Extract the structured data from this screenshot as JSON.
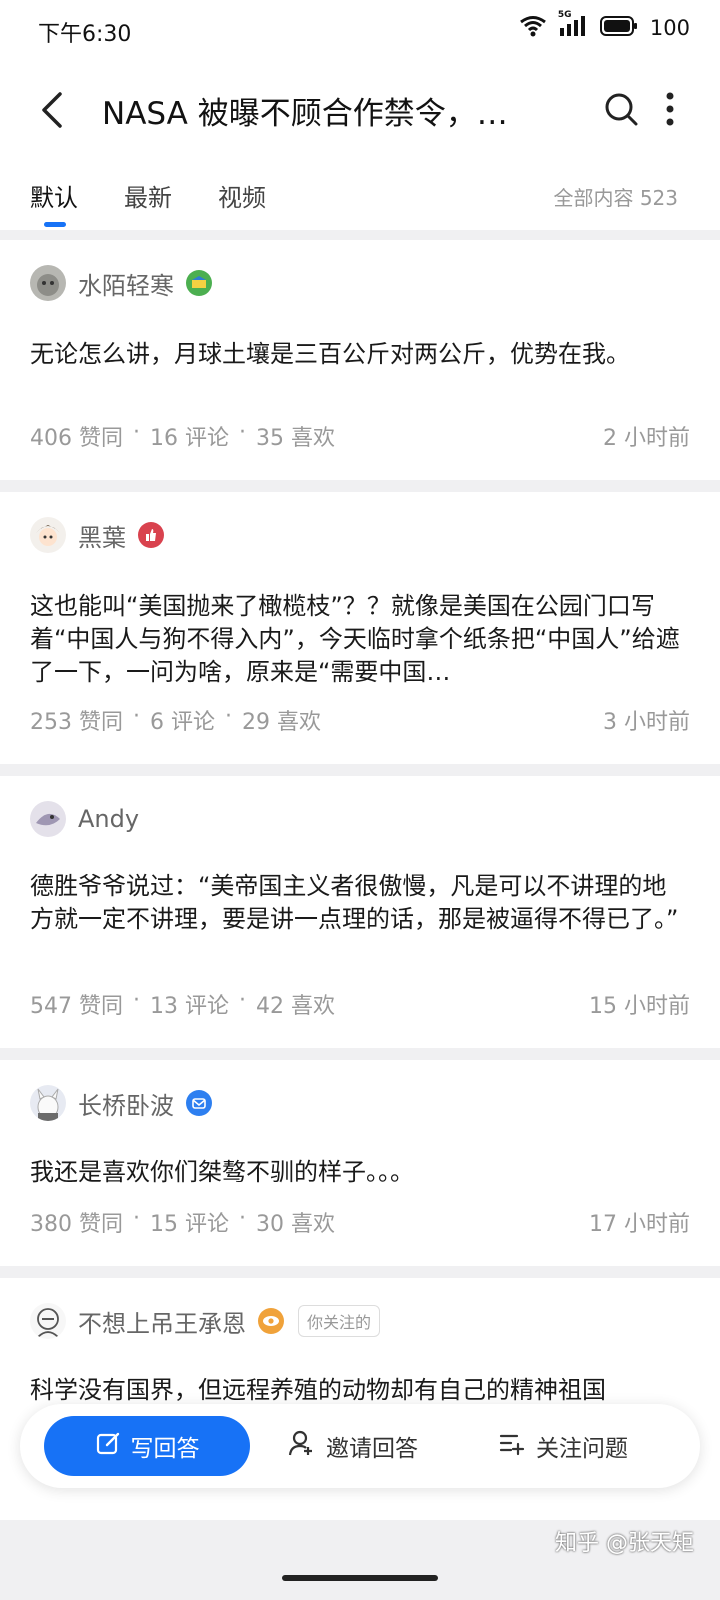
{
  "status": {
    "time": "下午6:30",
    "network": "5G",
    "battery": "100"
  },
  "header": {
    "title": "NASA 被曝不顾合作禁令，…"
  },
  "tabs": {
    "items": [
      {
        "label": "默认",
        "active": true
      },
      {
        "label": "最新",
        "active": false
      },
      {
        "label": "视频",
        "active": false
      }
    ],
    "count": "全部内容 523"
  },
  "answers": [
    {
      "author": "水陌轻寒",
      "content": "无论怎么讲，月球土壤是三百公斤对两公斤，优势在我。",
      "likes": "406 赞同",
      "comments": "16 评论",
      "favs": "35 喜欢",
      "time": "2 小时前"
    },
    {
      "author": "黑葉",
      "content": "这也能叫“美国抛来了橄榄枝”？？就像是美国在公园门口写着“中国人与狗不得入内”，今天临时拿个纸条把“中国人”给遮了一下，一问为啥，原来是“需要中国…",
      "likes": "253 赞同",
      "comments": "6 评论",
      "favs": "29 喜欢",
      "time": "3 小时前"
    },
    {
      "author": "Andy",
      "content": "德胜爷爷说过：“美帝国主义者很傲慢，凡是可以不讲理的地方就一定不讲理，要是讲一点理的话，那是被逼得不得已了。”",
      "likes": "547 赞同",
      "comments": "13 评论",
      "favs": "42 喜欢",
      "time": "15 小时前"
    },
    {
      "author": "长桥卧波",
      "content": "我还是喜欢你们桀骜不驯的样子。。。",
      "likes": "380 赞同",
      "comments": "15 评论",
      "favs": "30 喜欢",
      "time": "17 小时前"
    },
    {
      "author": "不想上吊王承恩",
      "tag": "你关注的",
      "content": "科学没有国界，但远程养殖的动物却有自己的精神祖国"
    }
  ],
  "bottom": {
    "write": "写回答",
    "invite": "邀请回答",
    "follow": "关注问题"
  },
  "watermark": "知乎 @张天矩"
}
